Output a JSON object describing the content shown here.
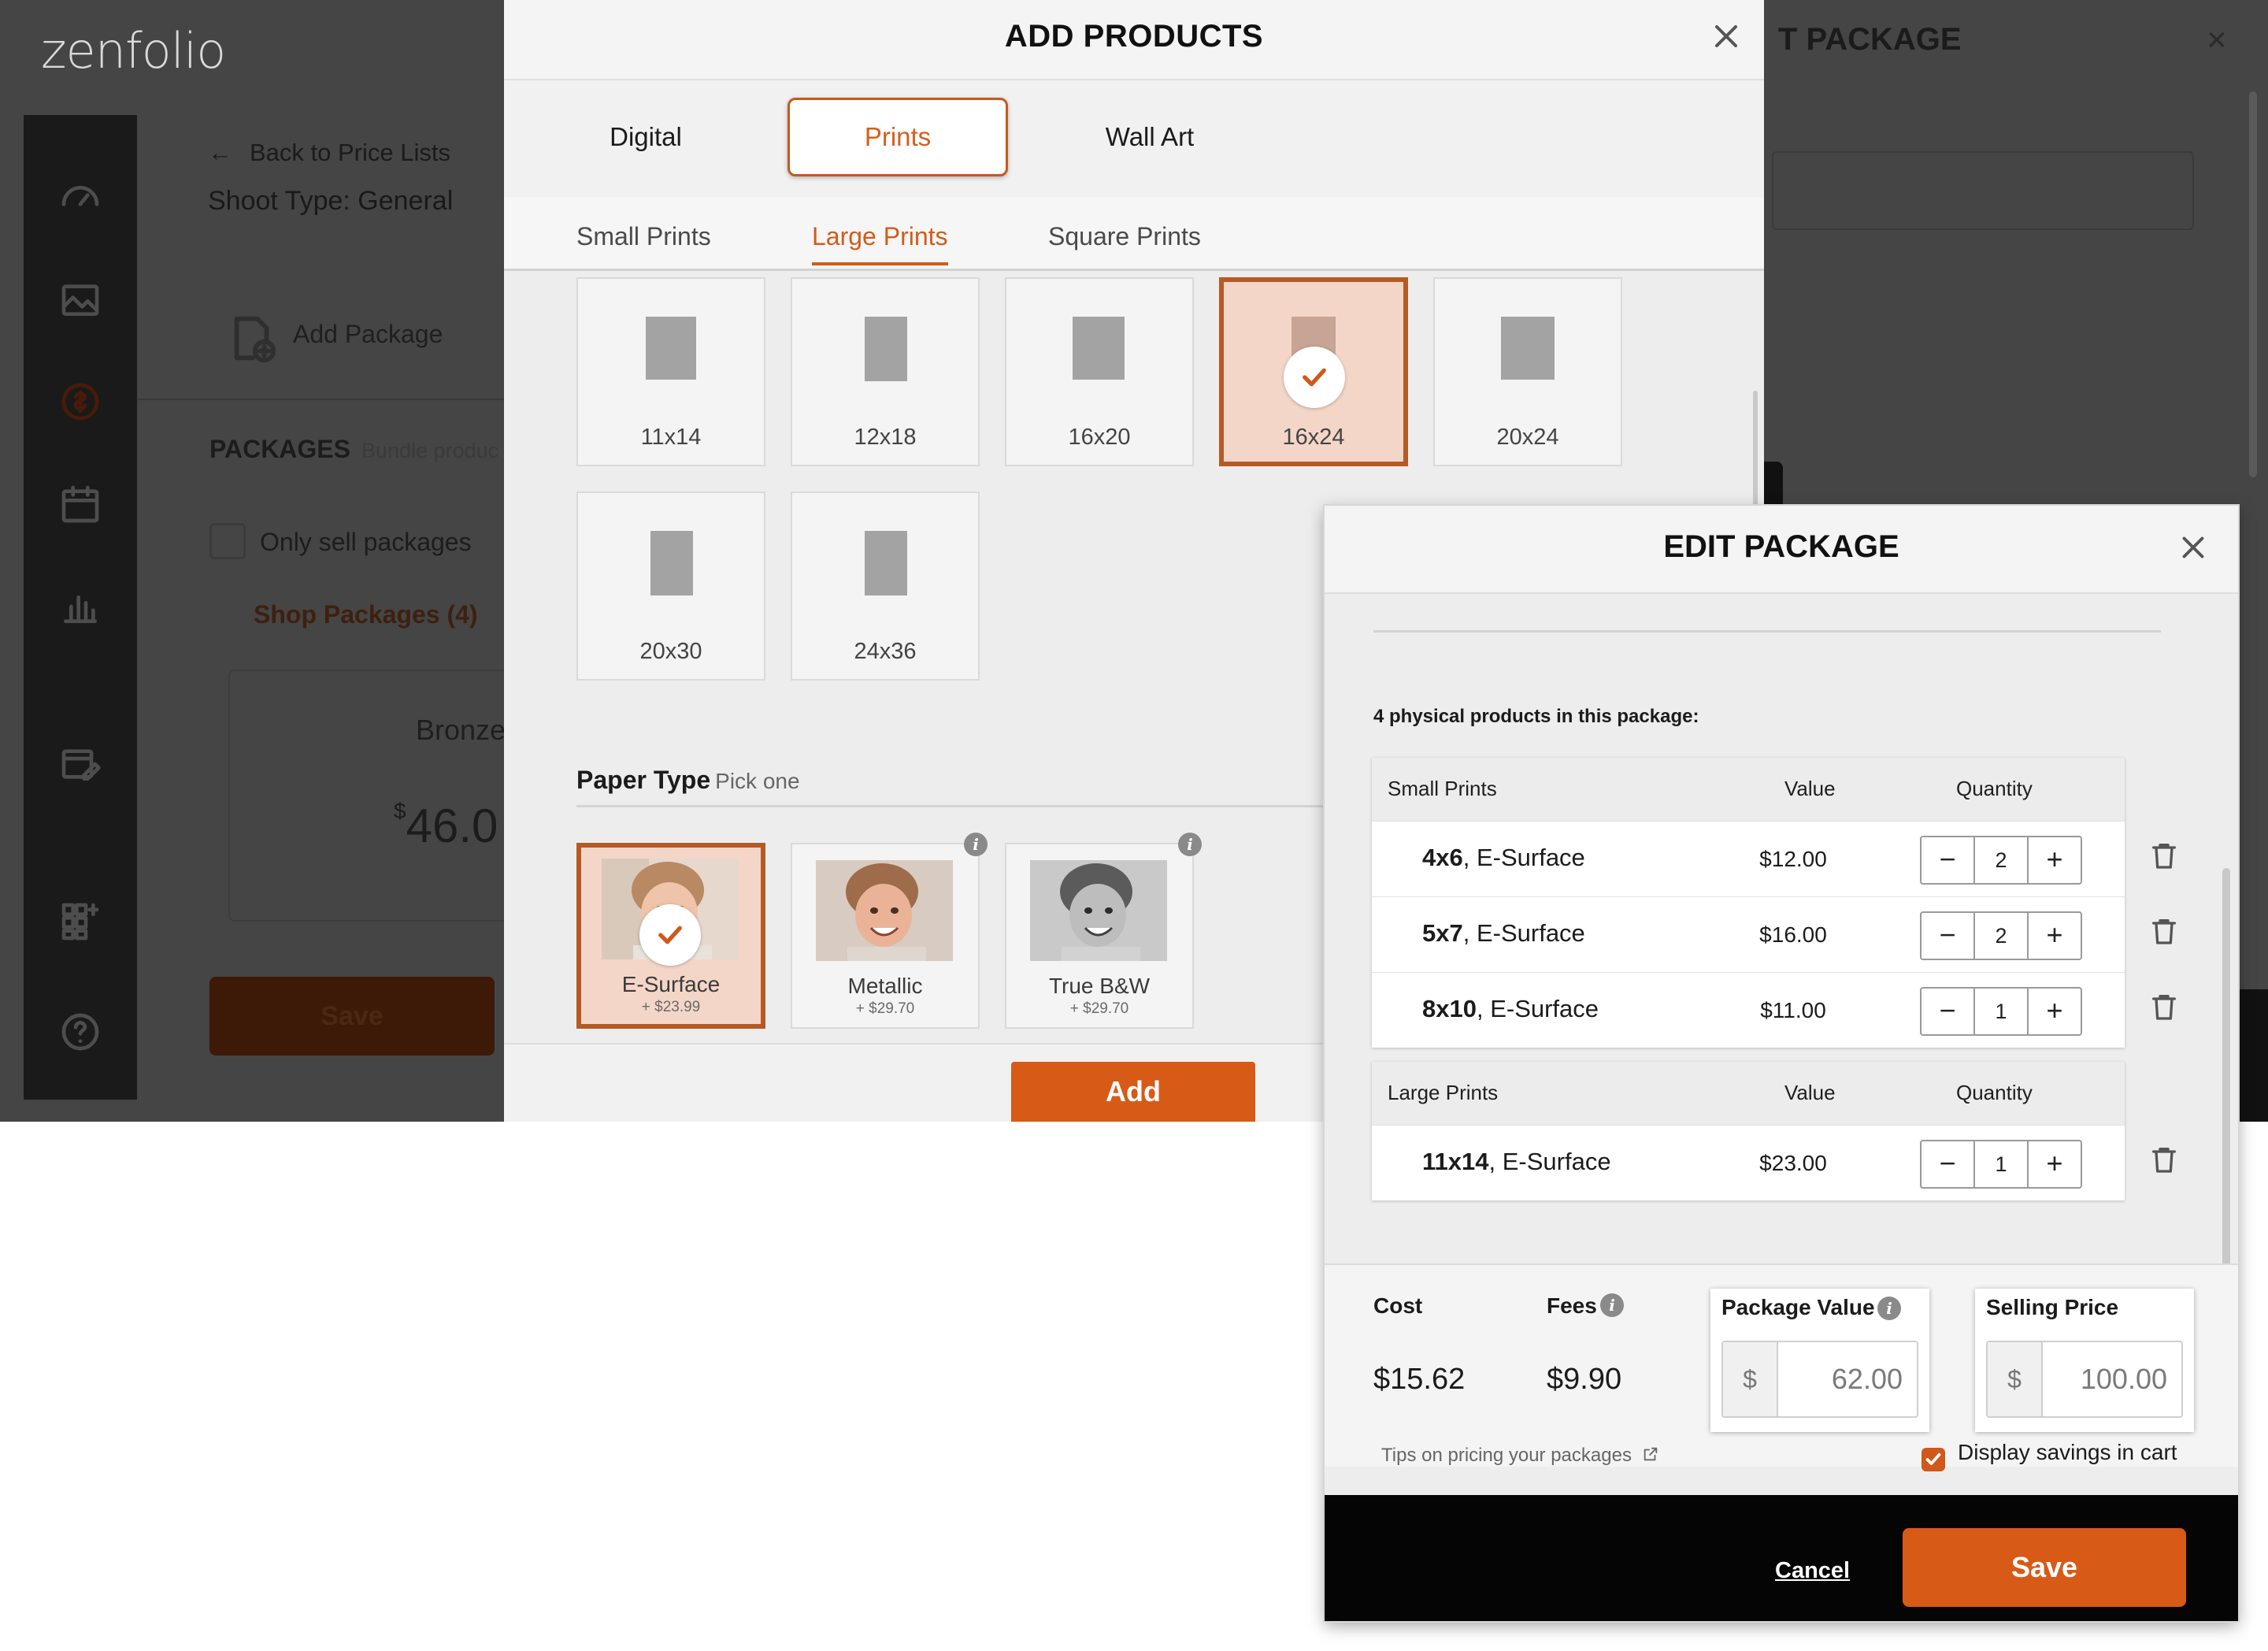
{
  "background": {
    "logo": "zenfolio",
    "back_link": "Back to Price Lists",
    "shoot_type": "Shoot Type: General",
    "add_package": "Add Package",
    "packages_title": "PACKAGES",
    "packages_sub": "Bundle produc",
    "only_sell": "Only sell packages",
    "shop_packages": "Shop Packages (4)",
    "card_title": "Bronze",
    "card_price_sup": "$",
    "card_price": "46.0",
    "save": "Save",
    "right_title": "T PACKAGE",
    "right_close": "×"
  },
  "add_products": {
    "title": "ADD PRODUCTS",
    "tabs": [
      "Digital",
      "Prints",
      "Wall Art"
    ],
    "active_tab": "Prints",
    "subtabs": [
      "Small Prints",
      "Large Prints",
      "Square Prints"
    ],
    "active_subtab": "Large Prints",
    "sizes": [
      "11x14",
      "12x18",
      "16x20",
      "16x24",
      "20x24",
      "20x30",
      "24x36"
    ],
    "selected_size": "16x24",
    "paper_type_label": "Paper Type",
    "paper_type_hint": "Pick one",
    "papers": [
      {
        "name": "E-Surface",
        "price": "+ $23.99"
      },
      {
        "name": "Metallic",
        "price": "+ $29.70"
      },
      {
        "name": "True B&W",
        "price": "+ $29.70"
      }
    ],
    "selected_paper": "E-Surface",
    "info_glyph": "i",
    "add_button": "Add"
  },
  "edit_package": {
    "title": "EDIT PACKAGE",
    "count_text": "4 physical products in this package:",
    "groups": [
      {
        "name": "Small Prints",
        "value_header": "Value",
        "quantity_header": "Quantity",
        "items": [
          {
            "size": "4x6",
            "paper": ", E-Surface",
            "value": "$12.00",
            "qty": "2"
          },
          {
            "size": "5x7",
            "paper": ", E-Surface",
            "value": "$16.00",
            "qty": "2"
          },
          {
            "size": "8x10",
            "paper": ", E-Surface",
            "value": "$11.00",
            "qty": "1"
          }
        ]
      },
      {
        "name": "Large Prints",
        "value_header": "Value",
        "quantity_header": "Quantity",
        "items": [
          {
            "size": "11x14",
            "paper": ", E-Surface",
            "value": "$23.00",
            "qty": "1"
          }
        ]
      }
    ],
    "minus": "−",
    "plus": "+",
    "cost_label": "Cost",
    "cost_value": "$15.62",
    "fees_label": "Fees",
    "fees_value": "$9.90",
    "package_value_label": "Package Value",
    "package_value": "62.00",
    "selling_price_label": "Selling Price",
    "selling_price": "100.00",
    "currency": "$",
    "tips_link": "Tips on pricing your packages",
    "display_savings": "Display savings in cart",
    "cancel": "Cancel",
    "save": "Save",
    "accent_color": "#d85a17"
  }
}
